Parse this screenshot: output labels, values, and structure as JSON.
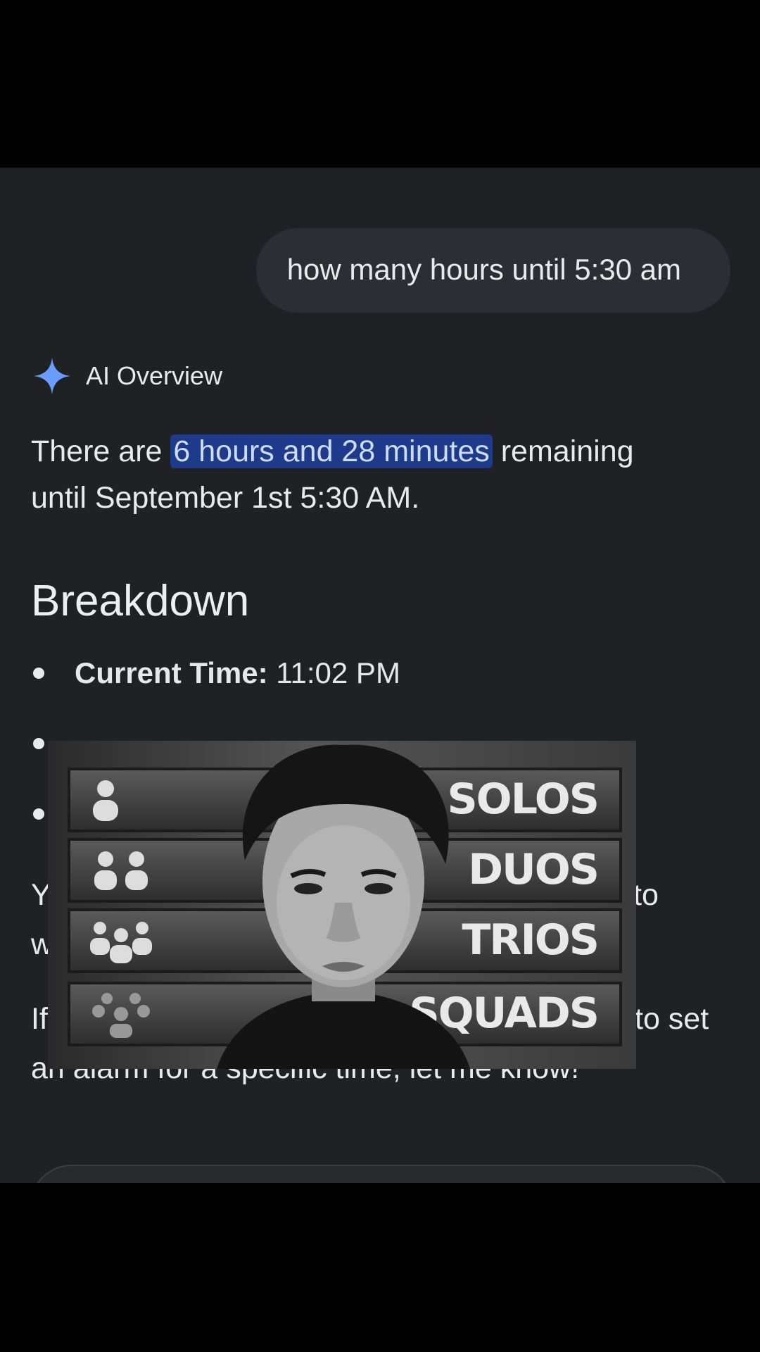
{
  "query": {
    "text": "how many hours until 5:30 am"
  },
  "ai_overview": {
    "label": "AI Overview"
  },
  "answer": {
    "before": "There are ",
    "highlight": "6 hours and 28 minutes",
    "after_line1": " remaining",
    "line2": "until September 1st 5:30 AM."
  },
  "breakdown": {
    "heading": "Breakdown",
    "items": [
      {
        "label": "Current Time:",
        "value": " 11:02 PM"
      }
    ]
  },
  "paragraphs": [
    {
      "left": "Y",
      "right": "to"
    },
    {
      "left": "w",
      "right": ""
    },
    {
      "left": "If",
      "right": "to set"
    },
    {
      "left": "an alarm for a specific time, let me know!",
      "right": ""
    }
  ],
  "overlay": {
    "panels": [
      "SOLOS",
      "DUOS",
      "TRIOS",
      "SQUADS"
    ]
  },
  "colors": {
    "background": "#202125",
    "highlight_bg": "#1e3a8a",
    "sparkle": "#6b9cff"
  }
}
